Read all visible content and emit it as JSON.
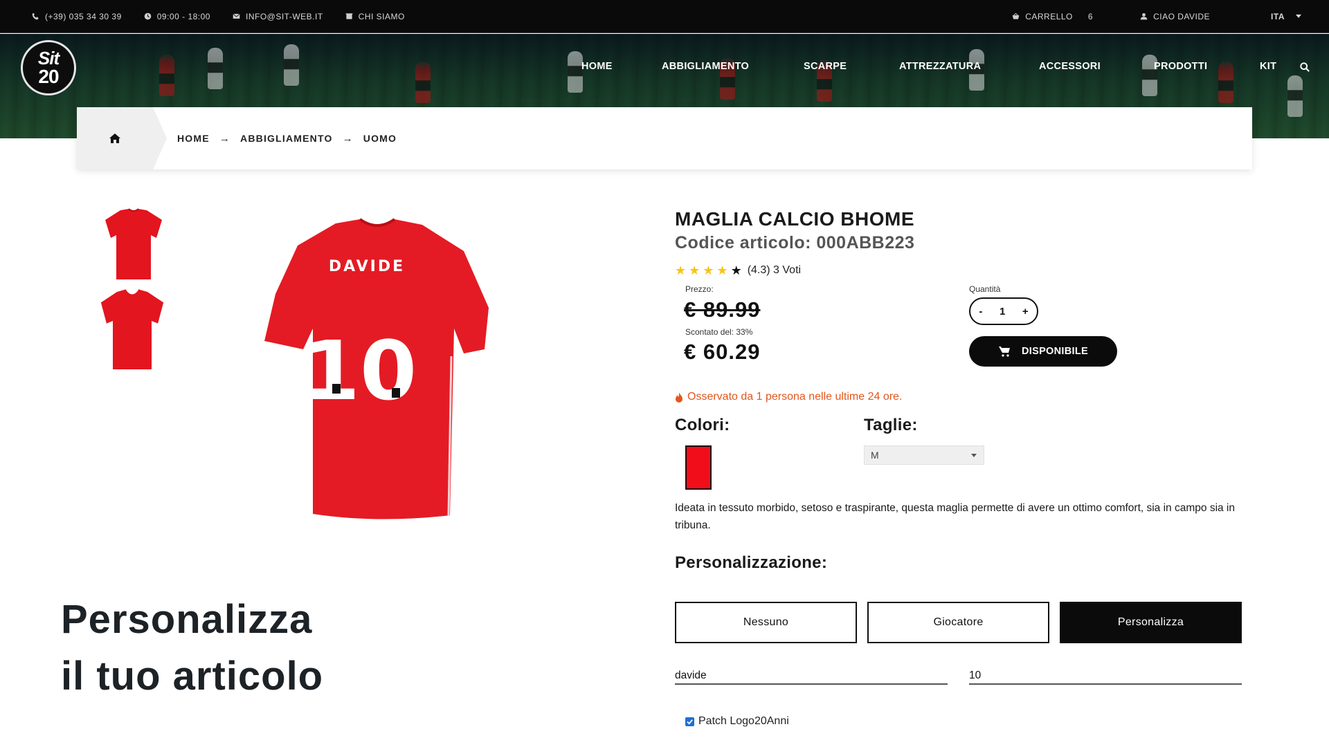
{
  "topbar": {
    "phone": "(+39) 035 34 30 39",
    "hours": "09:00 - 18:00",
    "email": "INFO@SIT-WEB.IT",
    "about": "CHI SIAMO",
    "cart_label": "CARRELLO",
    "cart_count": "6",
    "user": "CIAO DAVIDE",
    "language": "ITA"
  },
  "logo": {
    "line1": "Sit",
    "line2": "20"
  },
  "nav": {
    "items": [
      "HOME",
      "ABBIGLIAMENTO",
      "SCARPE",
      "ATTREZZATURA",
      "ACCESSORI",
      "PRODOTTI",
      "KIT"
    ]
  },
  "breadcrumb": {
    "items": [
      "HOME",
      "ABBIGLIAMENTO",
      "UOMO"
    ]
  },
  "product": {
    "title": "MAGLIA CALCIO BHOME",
    "code": "Codice articolo: 000ABB223",
    "rating_text": "(4.3) 3 Voti",
    "rating_value": 4.3,
    "rating_max": 5,
    "price_label": "Prezzo:",
    "old_price": "€ 89.99",
    "discount_label": "Scontato del: 33%",
    "new_price": "€ 60.29",
    "quantity_label": "Quantità",
    "quantity": "1",
    "qty_minus": "-",
    "qty_plus": "+",
    "availability_button": "DISPONIBILE",
    "observed": "Osservato da 1 persona nelle ultime 24 ore.",
    "colors_heading": "Colori:",
    "sizes_heading": "Taglie:",
    "selected_color": "#f20d1a",
    "selected_size": "M",
    "description": "Ideata in tessuto morbido, setoso e traspirante, questa maglia permette di avere un ottimo comfort, sia in campo sia in tribuna.",
    "jersey_name": "DAVIDE",
    "jersey_number": "10"
  },
  "personalization": {
    "heading": "Personalizzazione:",
    "options": [
      "Nessuno",
      "Giocatore",
      "Personalizza"
    ],
    "active_option": "Personalizza",
    "name_value": "davide",
    "number_value": "10",
    "patch_label": "Patch Logo20Anni",
    "patch_checked": true
  },
  "promo": {
    "line1": "Personalizza",
    "line2": "il tuo articolo"
  }
}
